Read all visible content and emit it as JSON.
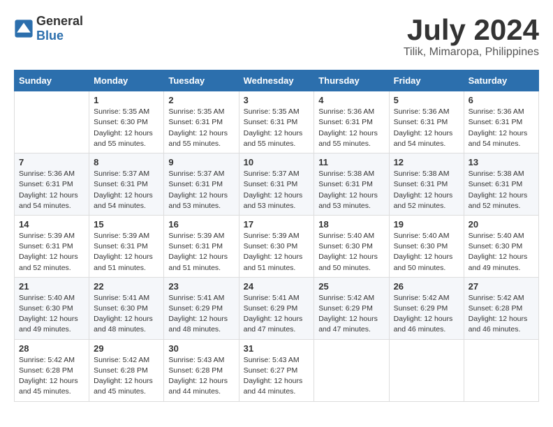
{
  "logo": {
    "general": "General",
    "blue": "Blue"
  },
  "title": {
    "month": "July 2024",
    "location": "Tilik, Mimaropa, Philippines"
  },
  "weekdays": [
    "Sunday",
    "Monday",
    "Tuesday",
    "Wednesday",
    "Thursday",
    "Friday",
    "Saturday"
  ],
  "weeks": [
    [
      {
        "day": "",
        "sunrise": "",
        "sunset": "",
        "daylight": ""
      },
      {
        "day": "1",
        "sunrise": "Sunrise: 5:35 AM",
        "sunset": "Sunset: 6:30 PM",
        "daylight": "Daylight: 12 hours and 55 minutes."
      },
      {
        "day": "2",
        "sunrise": "Sunrise: 5:35 AM",
        "sunset": "Sunset: 6:31 PM",
        "daylight": "Daylight: 12 hours and 55 minutes."
      },
      {
        "day": "3",
        "sunrise": "Sunrise: 5:35 AM",
        "sunset": "Sunset: 6:31 PM",
        "daylight": "Daylight: 12 hours and 55 minutes."
      },
      {
        "day": "4",
        "sunrise": "Sunrise: 5:36 AM",
        "sunset": "Sunset: 6:31 PM",
        "daylight": "Daylight: 12 hours and 55 minutes."
      },
      {
        "day": "5",
        "sunrise": "Sunrise: 5:36 AM",
        "sunset": "Sunset: 6:31 PM",
        "daylight": "Daylight: 12 hours and 54 minutes."
      },
      {
        "day": "6",
        "sunrise": "Sunrise: 5:36 AM",
        "sunset": "Sunset: 6:31 PM",
        "daylight": "Daylight: 12 hours and 54 minutes."
      }
    ],
    [
      {
        "day": "7",
        "sunrise": "Sunrise: 5:36 AM",
        "sunset": "Sunset: 6:31 PM",
        "daylight": "Daylight: 12 hours and 54 minutes."
      },
      {
        "day": "8",
        "sunrise": "Sunrise: 5:37 AM",
        "sunset": "Sunset: 6:31 PM",
        "daylight": "Daylight: 12 hours and 54 minutes."
      },
      {
        "day": "9",
        "sunrise": "Sunrise: 5:37 AM",
        "sunset": "Sunset: 6:31 PM",
        "daylight": "Daylight: 12 hours and 53 minutes."
      },
      {
        "day": "10",
        "sunrise": "Sunrise: 5:37 AM",
        "sunset": "Sunset: 6:31 PM",
        "daylight": "Daylight: 12 hours and 53 minutes."
      },
      {
        "day": "11",
        "sunrise": "Sunrise: 5:38 AM",
        "sunset": "Sunset: 6:31 PM",
        "daylight": "Daylight: 12 hours and 53 minutes."
      },
      {
        "day": "12",
        "sunrise": "Sunrise: 5:38 AM",
        "sunset": "Sunset: 6:31 PM",
        "daylight": "Daylight: 12 hours and 52 minutes."
      },
      {
        "day": "13",
        "sunrise": "Sunrise: 5:38 AM",
        "sunset": "Sunset: 6:31 PM",
        "daylight": "Daylight: 12 hours and 52 minutes."
      }
    ],
    [
      {
        "day": "14",
        "sunrise": "Sunrise: 5:39 AM",
        "sunset": "Sunset: 6:31 PM",
        "daylight": "Daylight: 12 hours and 52 minutes."
      },
      {
        "day": "15",
        "sunrise": "Sunrise: 5:39 AM",
        "sunset": "Sunset: 6:31 PM",
        "daylight": "Daylight: 12 hours and 51 minutes."
      },
      {
        "day": "16",
        "sunrise": "Sunrise: 5:39 AM",
        "sunset": "Sunset: 6:31 PM",
        "daylight": "Daylight: 12 hours and 51 minutes."
      },
      {
        "day": "17",
        "sunrise": "Sunrise: 5:39 AM",
        "sunset": "Sunset: 6:30 PM",
        "daylight": "Daylight: 12 hours and 51 minutes."
      },
      {
        "day": "18",
        "sunrise": "Sunrise: 5:40 AM",
        "sunset": "Sunset: 6:30 PM",
        "daylight": "Daylight: 12 hours and 50 minutes."
      },
      {
        "day": "19",
        "sunrise": "Sunrise: 5:40 AM",
        "sunset": "Sunset: 6:30 PM",
        "daylight": "Daylight: 12 hours and 50 minutes."
      },
      {
        "day": "20",
        "sunrise": "Sunrise: 5:40 AM",
        "sunset": "Sunset: 6:30 PM",
        "daylight": "Daylight: 12 hours and 49 minutes."
      }
    ],
    [
      {
        "day": "21",
        "sunrise": "Sunrise: 5:40 AM",
        "sunset": "Sunset: 6:30 PM",
        "daylight": "Daylight: 12 hours and 49 minutes."
      },
      {
        "day": "22",
        "sunrise": "Sunrise: 5:41 AM",
        "sunset": "Sunset: 6:30 PM",
        "daylight": "Daylight: 12 hours and 48 minutes."
      },
      {
        "day": "23",
        "sunrise": "Sunrise: 5:41 AM",
        "sunset": "Sunset: 6:29 PM",
        "daylight": "Daylight: 12 hours and 48 minutes."
      },
      {
        "day": "24",
        "sunrise": "Sunrise: 5:41 AM",
        "sunset": "Sunset: 6:29 PM",
        "daylight": "Daylight: 12 hours and 47 minutes."
      },
      {
        "day": "25",
        "sunrise": "Sunrise: 5:42 AM",
        "sunset": "Sunset: 6:29 PM",
        "daylight": "Daylight: 12 hours and 47 minutes."
      },
      {
        "day": "26",
        "sunrise": "Sunrise: 5:42 AM",
        "sunset": "Sunset: 6:29 PM",
        "daylight": "Daylight: 12 hours and 46 minutes."
      },
      {
        "day": "27",
        "sunrise": "Sunrise: 5:42 AM",
        "sunset": "Sunset: 6:28 PM",
        "daylight": "Daylight: 12 hours and 46 minutes."
      }
    ],
    [
      {
        "day": "28",
        "sunrise": "Sunrise: 5:42 AM",
        "sunset": "Sunset: 6:28 PM",
        "daylight": "Daylight: 12 hours and 45 minutes."
      },
      {
        "day": "29",
        "sunrise": "Sunrise: 5:42 AM",
        "sunset": "Sunset: 6:28 PM",
        "daylight": "Daylight: 12 hours and 45 minutes."
      },
      {
        "day": "30",
        "sunrise": "Sunrise: 5:43 AM",
        "sunset": "Sunset: 6:28 PM",
        "daylight": "Daylight: 12 hours and 44 minutes."
      },
      {
        "day": "31",
        "sunrise": "Sunrise: 5:43 AM",
        "sunset": "Sunset: 6:27 PM",
        "daylight": "Daylight: 12 hours and 44 minutes."
      },
      {
        "day": "",
        "sunrise": "",
        "sunset": "",
        "daylight": ""
      },
      {
        "day": "",
        "sunrise": "",
        "sunset": "",
        "daylight": ""
      },
      {
        "day": "",
        "sunrise": "",
        "sunset": "",
        "daylight": ""
      }
    ]
  ]
}
